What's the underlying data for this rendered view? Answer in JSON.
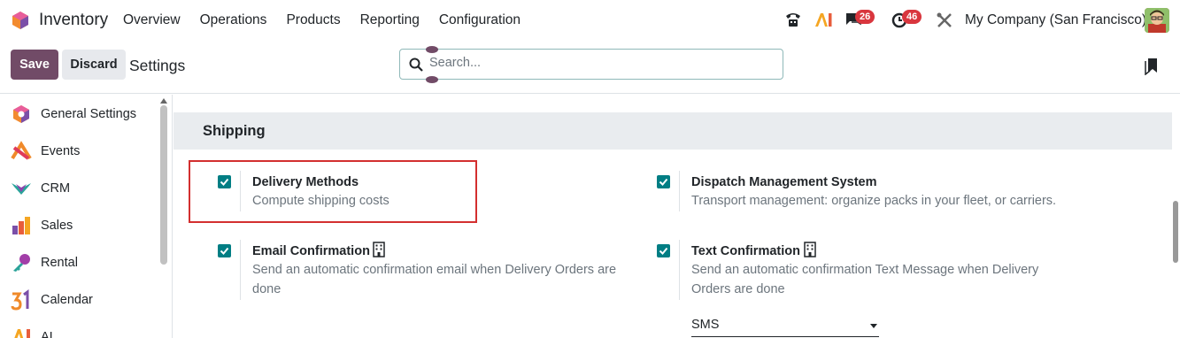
{
  "app": {
    "name": "Inventory",
    "menu": [
      "Overview",
      "Operations",
      "Products",
      "Reporting",
      "Configuration"
    ]
  },
  "systray": {
    "messages_count": "26",
    "activities_count": "46",
    "company": "My Company (San Francisco)"
  },
  "control_panel": {
    "save_label": "Save",
    "discard_label": "Discard",
    "breadcrumb": "Settings",
    "search_placeholder": "Search..."
  },
  "sidebar": {
    "items": [
      {
        "label": "General Settings",
        "icon": "general-settings-icon"
      },
      {
        "label": "Events",
        "icon": "events-icon"
      },
      {
        "label": "CRM",
        "icon": "crm-icon"
      },
      {
        "label": "Sales",
        "icon": "sales-icon"
      },
      {
        "label": "Rental",
        "icon": "rental-icon"
      },
      {
        "label": "Calendar",
        "icon": "calendar-icon"
      },
      {
        "label": "AI",
        "icon": "ai-icon"
      }
    ]
  },
  "section": {
    "title": "Shipping",
    "settings": [
      {
        "title": "Delivery Methods",
        "desc": "Compute shipping costs",
        "checked": true
      },
      {
        "title": "Dispatch Management System",
        "desc": "Transport management: organize packs in your fleet, or carriers.",
        "checked": true
      },
      {
        "title": "Email Confirmation",
        "desc": "Send an automatic confirmation email when Delivery Orders are done",
        "checked": true
      },
      {
        "title": "Text Confirmation",
        "desc": "Send an automatic confirmation Text Message when Delivery Orders are done",
        "checked": true,
        "select_value": "SMS"
      }
    ]
  },
  "colors": {
    "brand": "#714b67",
    "checkbox": "#017e84",
    "badge": "#d9363e",
    "highlight": "#d32f2f"
  }
}
